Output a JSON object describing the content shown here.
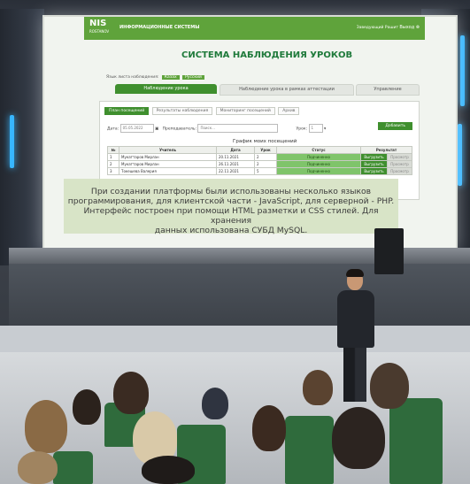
{
  "screen": {
    "logo_main": "NIS",
    "logo_sub": "ROSTANOV",
    "app_name": "ИНФОРМАЦИОННЫЕ СИСТЕМЫ",
    "header_user": "Заведующий Рашит",
    "header_exit": "Выход",
    "page_title": "СИСТЕМА НАБЛЮДЕНИЯ УРОКОВ",
    "language_label": "Язык листа наблюдения:",
    "languages": [
      "Казах",
      "Русский"
    ],
    "main_tabs": [
      "Наблюдение урока",
      "Наблюдение урока в рамках аттестации",
      "Управление"
    ],
    "sub_tabs": [
      "План посещений",
      "Результаты наблюдения",
      "Мониторинг посещений",
      "Архив"
    ],
    "filter_date_label": "Дата:",
    "filter_date_value": "05.05.2022",
    "filter_teacher_label": "Преподаватель:",
    "filter_teacher_placeholder": "Поиск...",
    "filter_lesson_label": "Урок:",
    "filter_lesson_value": "1",
    "add_button": "Добавить",
    "table_title": "График моих посещений",
    "table_headers": [
      "№",
      "Учитель",
      "Дата",
      "Урок",
      "Статус",
      "Результат"
    ],
    "rows": [
      {
        "n": "1",
        "teacher": "Мукаттаров Мирлан",
        "date": "20.11.2021",
        "lesson": "2",
        "status": "Подчиненно",
        "r1": "Выгрузить",
        "r2": "Просмотр"
      },
      {
        "n": "2",
        "teacher": "Мукаттаров Мирлан",
        "date": "26.11.2021",
        "lesson": "2",
        "status": "Подчиненно",
        "r1": "Выгрузить",
        "r2": "Просмотр"
      },
      {
        "n": "3",
        "teacher": "Токешева Валерия",
        "date": "22.11.2021",
        "lesson": "5",
        "status": "Подчиненно",
        "r1": "Выгрузить",
        "r2": "Просмотр"
      }
    ]
  },
  "caption": {
    "line1": "При создании платформы были использованы несколько языков",
    "line2": "программирования, для клиентской части - JavaScript, для серверной - PHP.",
    "line3": "Интерфейс построен при помощи HTML разметки и CSS стилей. Для хранения",
    "line4": "данных использована СУБД MySQL."
  },
  "colors": {
    "accent_green": "#5fa33b",
    "dark_green": "#3f8f2e",
    "caption_bg": "#d6e2c4",
    "led_blue": "#37b6ff"
  }
}
